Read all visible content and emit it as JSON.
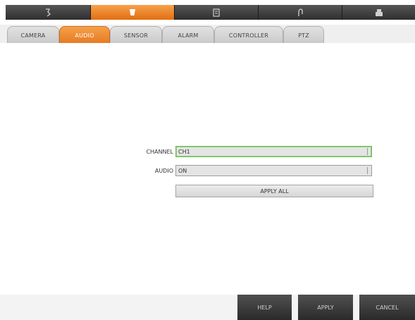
{
  "top_nav": {
    "buttons": [
      {
        "icon": "camera-icon"
      },
      {
        "icon": "cup-icon",
        "active": true
      },
      {
        "icon": "document-icon"
      },
      {
        "icon": "link-icon"
      },
      {
        "icon": "printer-icon"
      }
    ],
    "accent": "#e97a24"
  },
  "tabs": [
    {
      "label": "CAMERA"
    },
    {
      "label": "AUDIO",
      "active": true
    },
    {
      "label": "SENSOR"
    },
    {
      "label": "ALARM"
    },
    {
      "label": "CONTROLLER"
    },
    {
      "label": "PTZ"
    }
  ],
  "form": {
    "channel_label": "CHANNEL",
    "channel_value": "CH1",
    "audio_label": "AUDIO",
    "audio_value": "ON",
    "apply_all_label": "APPLY ALL"
  },
  "footer": {
    "help_label": "HELP",
    "apply_label": "APPLY",
    "cancel_label": "CANCEL"
  }
}
